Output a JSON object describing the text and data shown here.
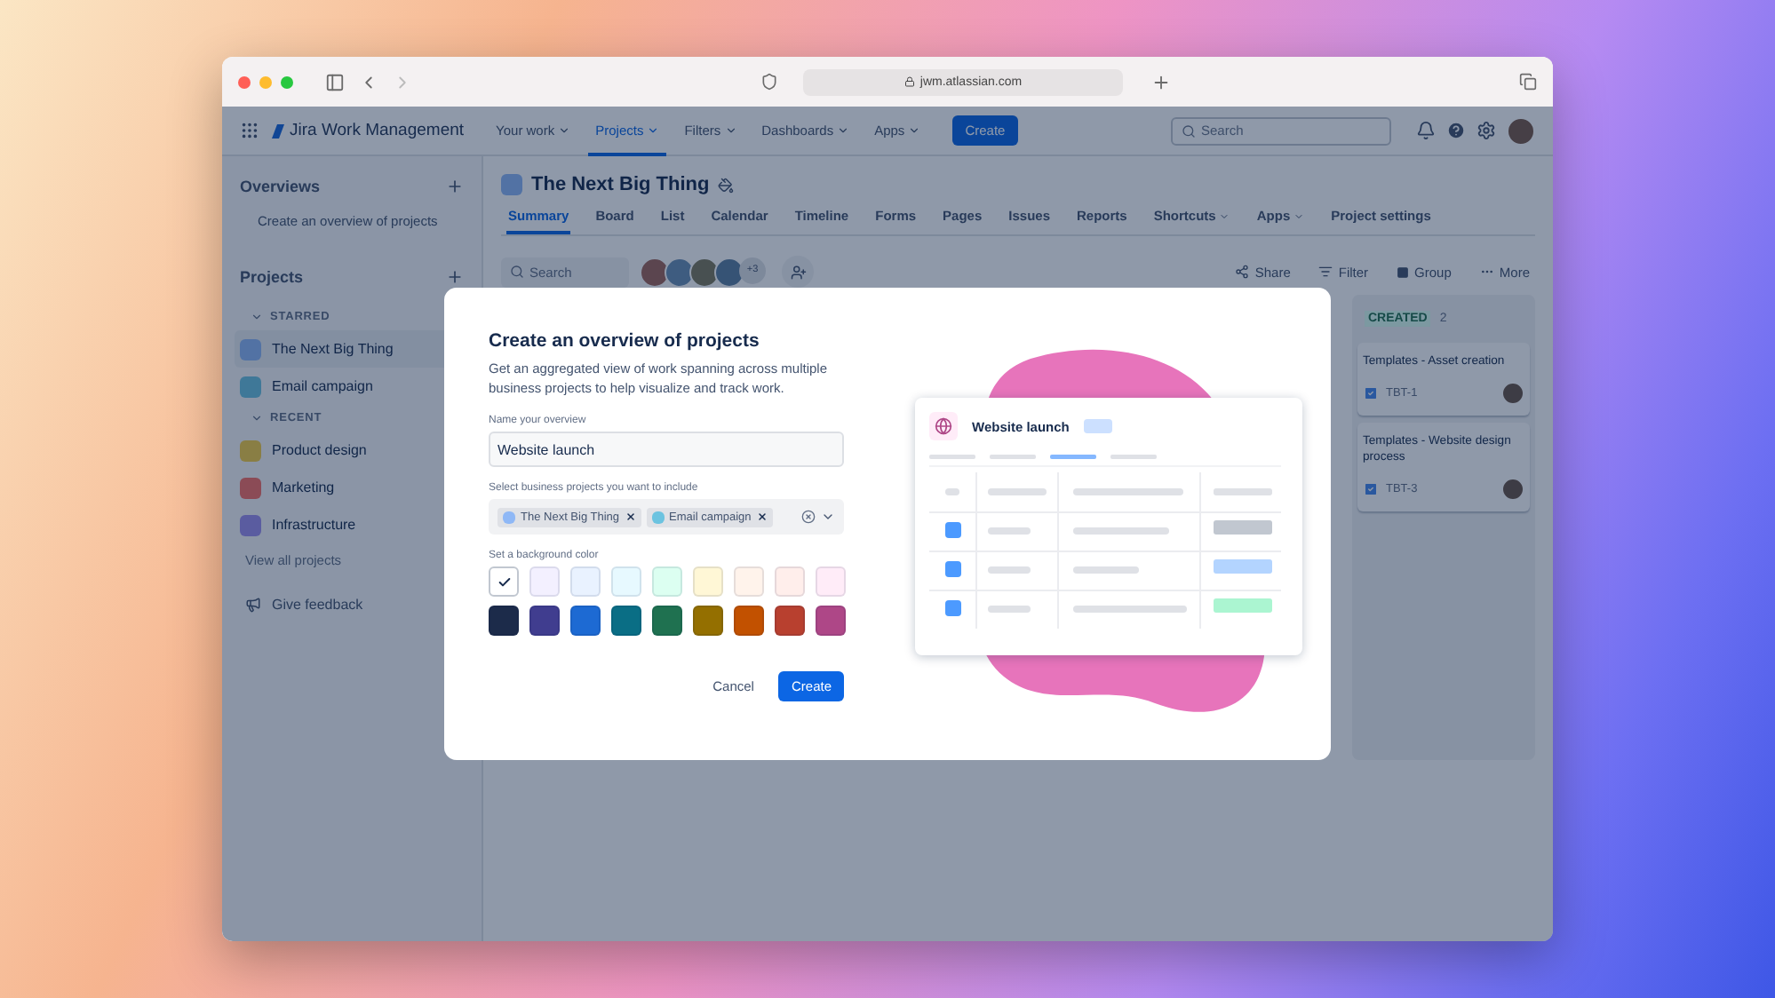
{
  "browser": {
    "url": "jwm.atlassian.com"
  },
  "nav": {
    "logo": "Jira Work Management",
    "items": [
      {
        "label": "Your work",
        "selected": false
      },
      {
        "label": "Projects",
        "selected": true
      },
      {
        "label": "Filters",
        "selected": false
      },
      {
        "label": "Dashboards",
        "selected": false
      },
      {
        "label": "Apps",
        "selected": false
      }
    ],
    "create": "Create",
    "search": {
      "placeholder": "Search"
    }
  },
  "sidebar": {
    "overviews_title": "Overviews",
    "overview_link": "Create an overview of projects",
    "projects_title": "Projects",
    "groups": [
      {
        "title": "STARRED",
        "expanded": true,
        "items": [
          {
            "name": "The Next Big Thing",
            "selected": true
          },
          {
            "name": "Email campaign",
            "selected": false
          }
        ]
      },
      {
        "title": "RECENT",
        "expanded": true,
        "items": [
          {
            "name": "Product design",
            "selected": false
          },
          {
            "name": "Marketing",
            "selected": false
          },
          {
            "name": "Infrastructure",
            "selected": false
          }
        ]
      }
    ],
    "view_all": "View all projects",
    "feedback": "Give feedback"
  },
  "project": {
    "title": "The Next Big Thing",
    "tabs": [
      {
        "label": "Summary",
        "selected": true,
        "dropdown": false
      },
      {
        "label": "Board",
        "selected": false,
        "dropdown": false
      },
      {
        "label": "List",
        "selected": false,
        "dropdown": false
      },
      {
        "label": "Calendar",
        "selected": false,
        "dropdown": false
      },
      {
        "label": "Timeline",
        "selected": false,
        "dropdown": false
      },
      {
        "label": "Forms",
        "selected": false,
        "dropdown": false
      },
      {
        "label": "Pages",
        "selected": false,
        "dropdown": false
      },
      {
        "label": "Issues",
        "selected": false,
        "dropdown": false
      },
      {
        "label": "Reports",
        "selected": false,
        "dropdown": false
      },
      {
        "label": "Shortcuts",
        "selected": false,
        "dropdown": true
      },
      {
        "label": "Apps",
        "selected": false,
        "dropdown": true
      },
      {
        "label": "Project settings",
        "selected": false,
        "dropdown": false
      }
    ],
    "search": {
      "placeholder": "Search"
    },
    "more_members": "+3",
    "actions": [
      {
        "kind": "share",
        "label": "Share"
      },
      {
        "kind": "filter",
        "label": "Filter"
      },
      {
        "kind": "group",
        "label": "Group"
      },
      {
        "kind": "more",
        "label": "More"
      }
    ]
  },
  "board": {
    "columns": [
      {
        "title": "CREATED",
        "count": "2",
        "cards": [
          {
            "title": "Templates - Asset creation",
            "key": "TBT-1"
          },
          {
            "title": "Templates - Website design process",
            "key": "TBT-3"
          }
        ]
      }
    ]
  },
  "modal": {
    "title": "Create an overview of projects",
    "description": "Get an aggregated view of work spanning across multiple business projects to help visualize and track work.",
    "name_label": "Name your overview",
    "name_value": "Website launch",
    "projects_label": "Select business projects you want to include",
    "projects": [
      {
        "name": "The Next Big Thing",
        "color": "#8fb8f6"
      },
      {
        "name": "Email campaign",
        "color": "#6cc3e0"
      }
    ],
    "color_label": "Set a background color",
    "colors": [
      {
        "color": "#ffffff",
        "selected": true
      },
      {
        "color": "#f3f0ff",
        "selected": false
      },
      {
        "color": "#e9f2ff",
        "selected": false
      },
      {
        "color": "#e7f9ff",
        "selected": false
      },
      {
        "color": "#dcfff1",
        "selected": false
      },
      {
        "color": "#fff7d6",
        "selected": false
      },
      {
        "color": "#fff3eb",
        "selected": false
      },
      {
        "color": "#ffeeeb",
        "selected": false
      },
      {
        "color": "#ffecf8",
        "selected": false
      },
      {
        "color": "#1c2b4a",
        "selected": false
      },
      {
        "color": "#403d8f",
        "selected": false
      },
      {
        "color": "#1d6ad3",
        "selected": false
      },
      {
        "color": "#0a6e85",
        "selected": false
      },
      {
        "color": "#1f7150",
        "selected": false
      },
      {
        "color": "#946f00",
        "selected": false
      },
      {
        "color": "#c25100",
        "selected": false
      },
      {
        "color": "#b8402f",
        "selected": false
      },
      {
        "color": "#ae4787",
        "selected": false
      }
    ],
    "cancel": "Cancel",
    "create": "Create",
    "preview": {
      "title": "Website launch"
    }
  }
}
